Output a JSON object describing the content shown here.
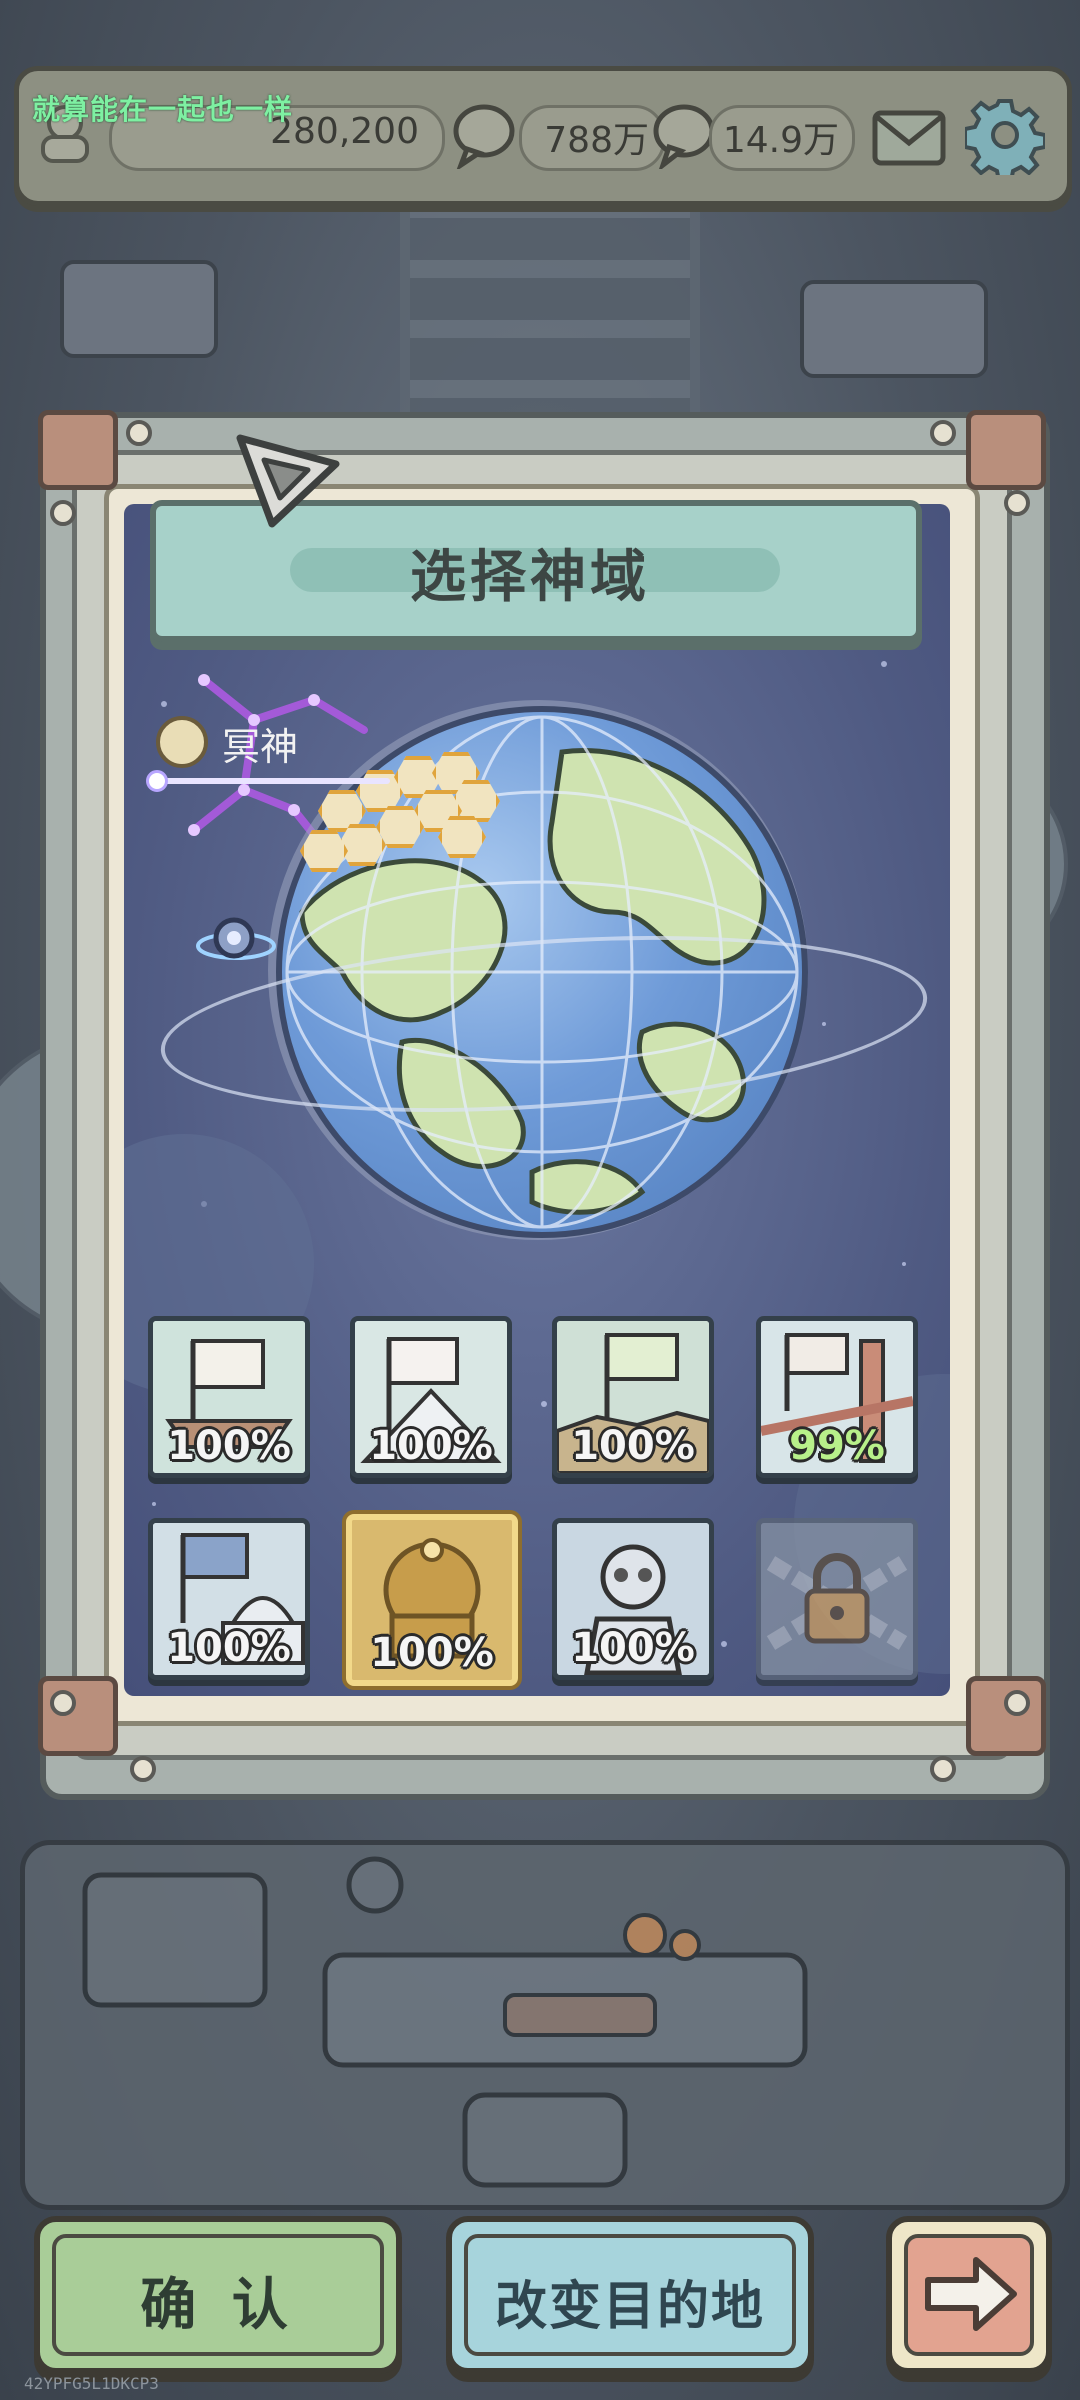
{
  "top_bar": {
    "chat_message": "就算能在一起也一样",
    "resource1_value": "280,200",
    "resource2_value": "788万",
    "resource3_value": "14.9万"
  },
  "dialog": {
    "title": "选择神域",
    "selected_god": "冥神"
  },
  "domain_cards": [
    {
      "progress": "100%",
      "icon": "ship-flag-card"
    },
    {
      "progress": "100%",
      "icon": "mountain-flag-card"
    },
    {
      "progress": "100%",
      "icon": "great-wall-flag-card"
    },
    {
      "progress": "99%",
      "icon": "bridge-flag-card"
    },
    {
      "progress": "100%",
      "icon": "palace-flag-card"
    },
    {
      "progress": "100%",
      "icon": "golden-temple-card"
    },
    {
      "progress": "100%",
      "icon": "robot-card"
    },
    {
      "progress": "",
      "icon": "lock-icon"
    }
  ],
  "buttons": {
    "confirm": "确 认",
    "change_destination": "改变目的地"
  },
  "watermark": "42YPFG5L1DKCP3",
  "colors": {
    "confirm_button": "#a9cd98",
    "change_button": "#a7d4dc",
    "next_button": "#e2a390",
    "title_banner": "#a7d1c9",
    "selected_card": "#d8b86b"
  }
}
